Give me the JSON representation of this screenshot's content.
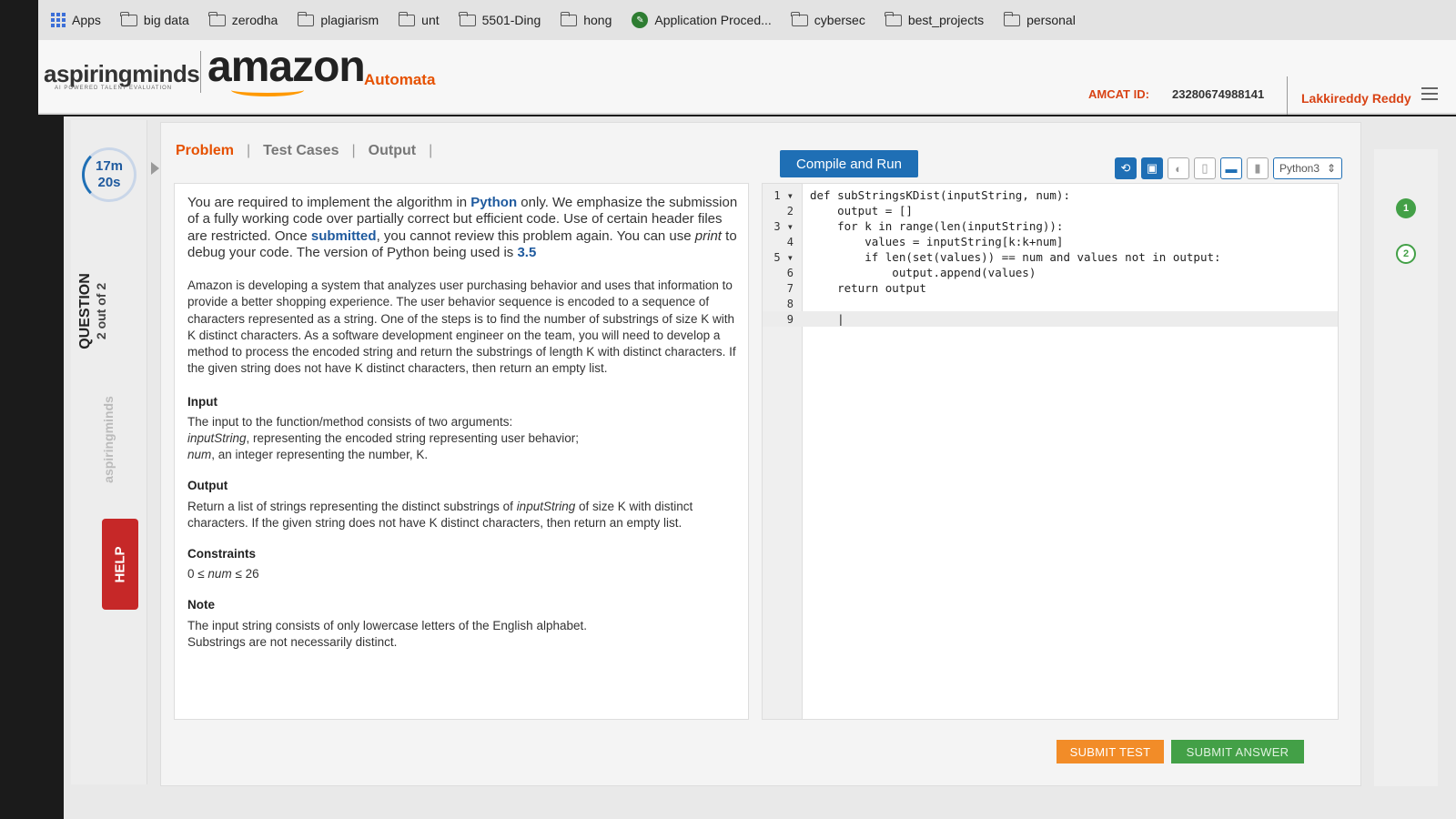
{
  "browser": {
    "url_fragment": "...VyZXZJ6IIIxIIaZtpcmVkZHIyonJIZGR5QGdtYWIsLmNv...",
    "bookmarks": [
      {
        "label": "Apps",
        "icon": "apps-grid-icon"
      },
      {
        "label": "big data",
        "icon": "folder-icon"
      },
      {
        "label": "zerodha",
        "icon": "folder-icon"
      },
      {
        "label": "plagiarism",
        "icon": "folder-icon"
      },
      {
        "label": "unt",
        "icon": "folder-icon"
      },
      {
        "label": "5501-Ding",
        "icon": "folder-icon"
      },
      {
        "label": "hong",
        "icon": "folder-icon"
      },
      {
        "label": "Application Proced...",
        "icon": "site-icon"
      },
      {
        "label": "cybersec",
        "icon": "folder-icon"
      },
      {
        "label": "best_projects",
        "icon": "folder-icon"
      },
      {
        "label": "personal",
        "icon": "folder-icon"
      }
    ]
  },
  "header": {
    "brand_main": "aspiring",
    "brand_accent": "minds",
    "brand_tagline": "AI POWERED TALENT EVALUATION",
    "partner": "amazon",
    "product": "Automata",
    "amcat_label": "AMCAT ID:",
    "amcat_id": "23280674988141",
    "user_name": "Lakkireddy Reddy"
  },
  "timer": {
    "minutes": "17m",
    "seconds": "20s"
  },
  "question": {
    "label": "QUESTION",
    "progress": "2 out of 2"
  },
  "side_logo": "aspiringminds",
  "help_label": "HELP",
  "tabs": [
    {
      "label": "Problem",
      "active": true
    },
    {
      "label": "Test Cases",
      "active": false
    },
    {
      "label": "Output",
      "active": false
    }
  ],
  "compile_button": "Compile and Run",
  "toolbar": {
    "language": "Python3"
  },
  "problem": {
    "intro": {
      "p1": "You are required to implement the algorithm in ",
      "p1_bold": "Python",
      "p2": " only. We emphasize the submission of a fully working code over partially correct but efficient code. Use of certain header files are restricted. Once ",
      "p2_bold": "submitted",
      "p3": ", you cannot review this problem again. You can use ",
      "p3_italic": "print",
      "p4": " to debug your code. The version of Python being used is ",
      "p4_bold": "3.5"
    },
    "description": "Amazon is developing a system that analyzes user purchasing behavior and uses that information to provide a better shopping experience.  The user behavior sequence is encoded to a sequence of characters represented as a string.  One of the steps is to find the number of substrings of size K with K distinct characters. As a software development engineer on the team, you will need to develop a method to process the encoded string and return the substrings of length K with distinct characters. If the given string does not have K distinct characters, then return an empty list.",
    "input_title": "Input",
    "input_intro": "The input to the function/method consists of two arguments:",
    "input_arg1_name": "inputString",
    "input_arg1_desc": ", representing the encoded string representing user behavior;",
    "input_arg2_name": "num",
    "input_arg2_desc": ", an integer representing the number, K.",
    "output_title": "Output",
    "output_p1": "Return a list of strings representing the distinct substrings of ",
    "output_italic": "inputString",
    "output_p2": " of size K with distinct characters. If the given string does not have K distinct characters, then return an empty list.",
    "constraints_title": "Constraints",
    "constraints_a": "0 ≤ ",
    "constraints_var": "num",
    "constraints_b": " ≤ 26",
    "note_title": "Note",
    "note_line1": "The input string consists of only lowercase letters of the English alphabet.",
    "note_line2": "Substrings are not necessarily distinct."
  },
  "code": {
    "lines": [
      {
        "num": "1 ▾",
        "text": "def subStringsKDist(inputString, num):"
      },
      {
        "num": "2",
        "text": "    output = []"
      },
      {
        "num": "3 ▾",
        "text": "    for k in range(len(inputString)):"
      },
      {
        "num": "4",
        "text": "        values = inputString[k:k+num]"
      },
      {
        "num": "5 ▾",
        "text": "        if len(set(values)) == num and values not in output:"
      },
      {
        "num": "6",
        "text": "            output.append(values)"
      },
      {
        "num": "7",
        "text": "    return output"
      },
      {
        "num": "8",
        "text": ""
      },
      {
        "num": "9",
        "text": "    |"
      }
    ]
  },
  "buttons": {
    "submit_test": "SUBMIT TEST",
    "submit_answer": "SUBMIT ANSWER"
  },
  "question_nav": [
    {
      "label": "1",
      "status": "done"
    },
    {
      "label": "2",
      "status": "current"
    }
  ]
}
